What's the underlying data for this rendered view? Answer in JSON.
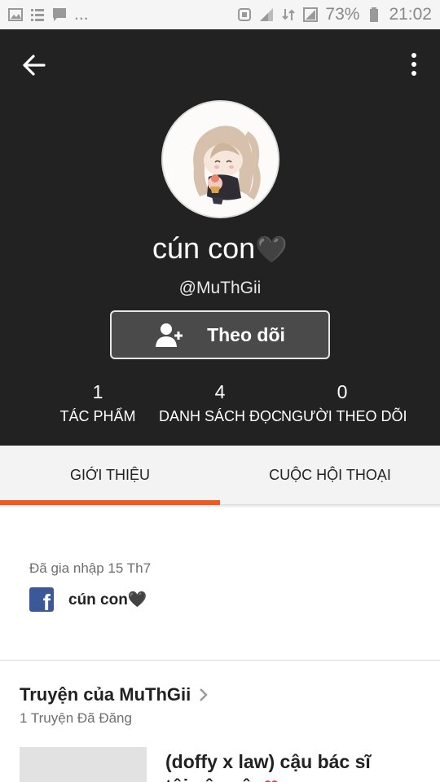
{
  "status_bar": {
    "left_icons": [
      "image-icon",
      "list-icon",
      "chat-icon",
      "more-dots-icon"
    ],
    "overflow": "...",
    "battery_percent": "73%",
    "time": "21:02"
  },
  "header": {
    "display_name": "cún con",
    "display_name_suffix": "🖤",
    "username": "@MuThGii",
    "follow_label": "Theo dõi"
  },
  "stats": [
    {
      "value": "1",
      "label": "TÁC PHẨM"
    },
    {
      "value": "4",
      "label": "DANH SÁCH ĐỌC"
    },
    {
      "value": "0",
      "label": "NGƯỜI THEO DÕI"
    }
  ],
  "tabs": [
    {
      "label": "GIỚI THIỆU",
      "active": true
    },
    {
      "label": "CUỘC HỘI THOẠI",
      "active": false
    }
  ],
  "about": {
    "joined": "Đã gia nhập 15 Th7",
    "facebook_name": "cún con",
    "facebook_suffix": "🖤"
  },
  "stories": {
    "title": "Truyện của MuThGii",
    "count": "1 Truyện Đã Đăng",
    "items": [
      {
        "title_line1": "(doffy x law) cậu bác sĩ",
        "title_line2": "tôi yêu cậu",
        "title_suffix": "❤"
      }
    ]
  },
  "colors": {
    "header_bg": "#222222",
    "accent": "#f05a22",
    "facebook": "#3b5998"
  }
}
